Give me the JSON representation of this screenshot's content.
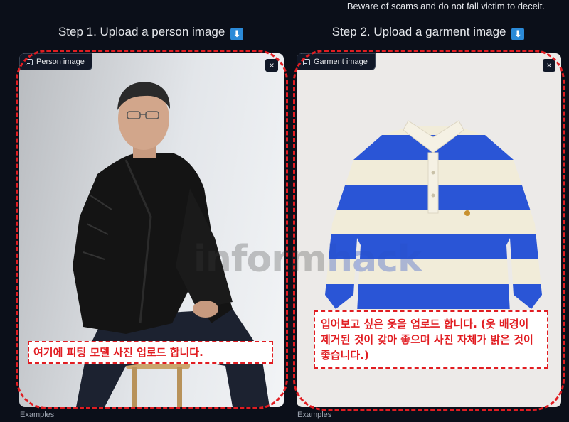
{
  "notice": "Beware of scams and do not fall victim to deceit.",
  "steps": {
    "person": {
      "title": "Step 1. Upload a person image",
      "label": "Person image",
      "close": "×"
    },
    "garment": {
      "title": "Step 2. Upload a garment image",
      "label": "Garment image",
      "close": "×"
    }
  },
  "arrow_emoji": "⬇",
  "annotations": {
    "person_note": "여기에 피팅 모델 사진 업로드 합니다.",
    "garment_note": "입어보고 싶은 옷을 업로드 합니다. (옷 배경이 제거된 것이 갖아 좋으며 사진 자체가 밝은 것이 좋습니다.)"
  },
  "watermark": {
    "part1": "inform",
    "part2": "hack"
  },
  "examples_label": "Examples",
  "colors": {
    "background": "#0b0f19",
    "panel": "#1f2937",
    "annotation_red": "#e11d22",
    "stripe_blue": "#2a55d6",
    "stripe_cream": "#f1ecd9"
  }
}
